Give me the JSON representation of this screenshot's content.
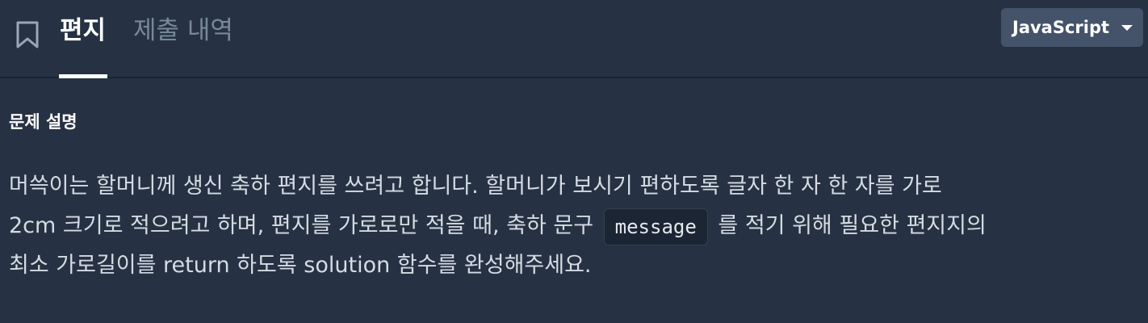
{
  "header": {
    "bookmark_icon": "bookmark-icon",
    "tabs": [
      {
        "label": "편지",
        "active": true
      },
      {
        "label": "제출 내역",
        "active": false
      }
    ],
    "language": {
      "selected": "JavaScript",
      "caret_icon": "caret-down-icon"
    }
  },
  "problem": {
    "section_title": "문제 설명",
    "description": {
      "line1": "머쓱이는 할머니께 생신 축하 편지를 쓰려고 합니다. 할머니가 보시기 편하도록 글자 한 자 한 자를 가로",
      "line2_before": "2cm 크기로 적으려고 하며, 편지를 가로로만 적을 때, 축하 문구",
      "line2_code": "message",
      "line2_after": "를 적기 위해 필요한 편지지의",
      "line3": "최소 가로길이를 return 하도록 solution 함수를 완성해주세요."
    }
  },
  "colors": {
    "background": "#263243",
    "active_tab": "#ffffff",
    "inactive_tab": "#78879a",
    "select_bg": "#44536a",
    "body_text": "#d5dbe3"
  }
}
